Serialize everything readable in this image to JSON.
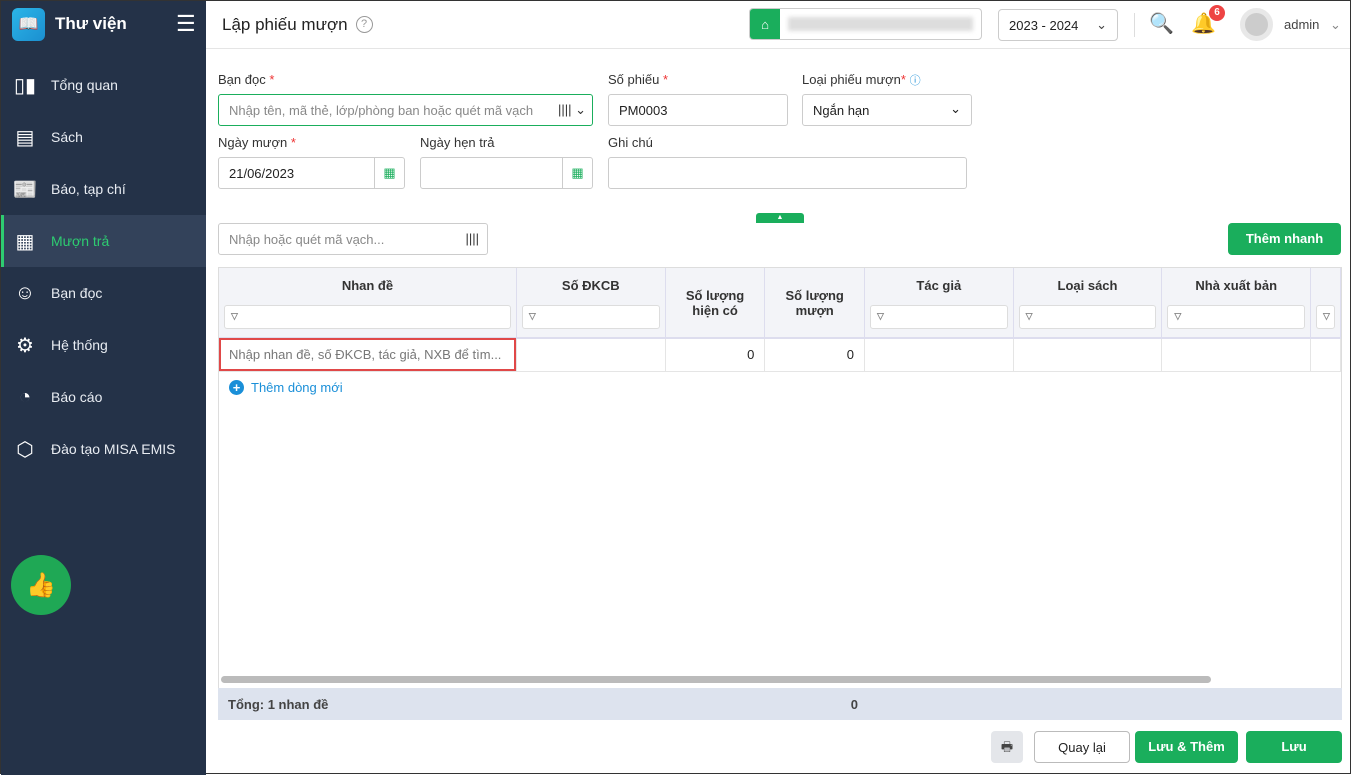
{
  "sidebar": {
    "app_name": "Thư viện",
    "items": [
      {
        "label": "Tổng quan",
        "icon": "chart"
      },
      {
        "label": "Sách",
        "icon": "book"
      },
      {
        "label": "Báo, tạp chí",
        "icon": "newspaper"
      },
      {
        "label": "Mượn trả",
        "icon": "borrow"
      },
      {
        "label": "Bạn đọc",
        "icon": "reader"
      },
      {
        "label": "Hệ thống",
        "icon": "gear"
      },
      {
        "label": "Báo cáo",
        "icon": "pie"
      },
      {
        "label": "Đào tạo MISA EMIS",
        "icon": "cube"
      }
    ]
  },
  "header": {
    "title": "Lập phiếu mượn",
    "year": "2023 - 2024",
    "notifications": "6",
    "user": "admin"
  },
  "form": {
    "reader_label": "Bạn đọc",
    "reader_placeholder": "Nhập tên, mã thẻ, lớp/phòng ban hoặc quét mã vạch",
    "slip_no_label": "Số phiếu",
    "slip_no": "PM0003",
    "type_label": "Loại phiếu mượn",
    "type_value": "Ngắn hạn",
    "borrow_date_label": "Ngày mượn",
    "borrow_date": "21/06/2023",
    "due_date_label": "Ngày hẹn trả",
    "due_date": "",
    "note_label": "Ghi chú",
    "note": "",
    "required": "*"
  },
  "barcode_placeholder": "Nhập hoặc quét mã vạch...",
  "quick_add": "Thêm nhanh",
  "table": {
    "columns": [
      "Nhan đề",
      "Số ĐKCB",
      "Số lượng hiện có",
      "Số lượng mượn",
      "Tác giả",
      "Loại sách",
      "Nhà xuất bản"
    ],
    "row": {
      "title_placeholder": "Nhập nhan đề, số ĐKCB, tác giả, NXB để tìm...",
      "available": "0",
      "borrowed": "0"
    },
    "add_row": "Thêm dòng mới",
    "footer_total": "Tổng: 1 nhan đề",
    "footer_borrowed": "0"
  },
  "buttons": {
    "back": "Quay lại",
    "save_add": "Lưu & Thêm",
    "save": "Lưu"
  }
}
